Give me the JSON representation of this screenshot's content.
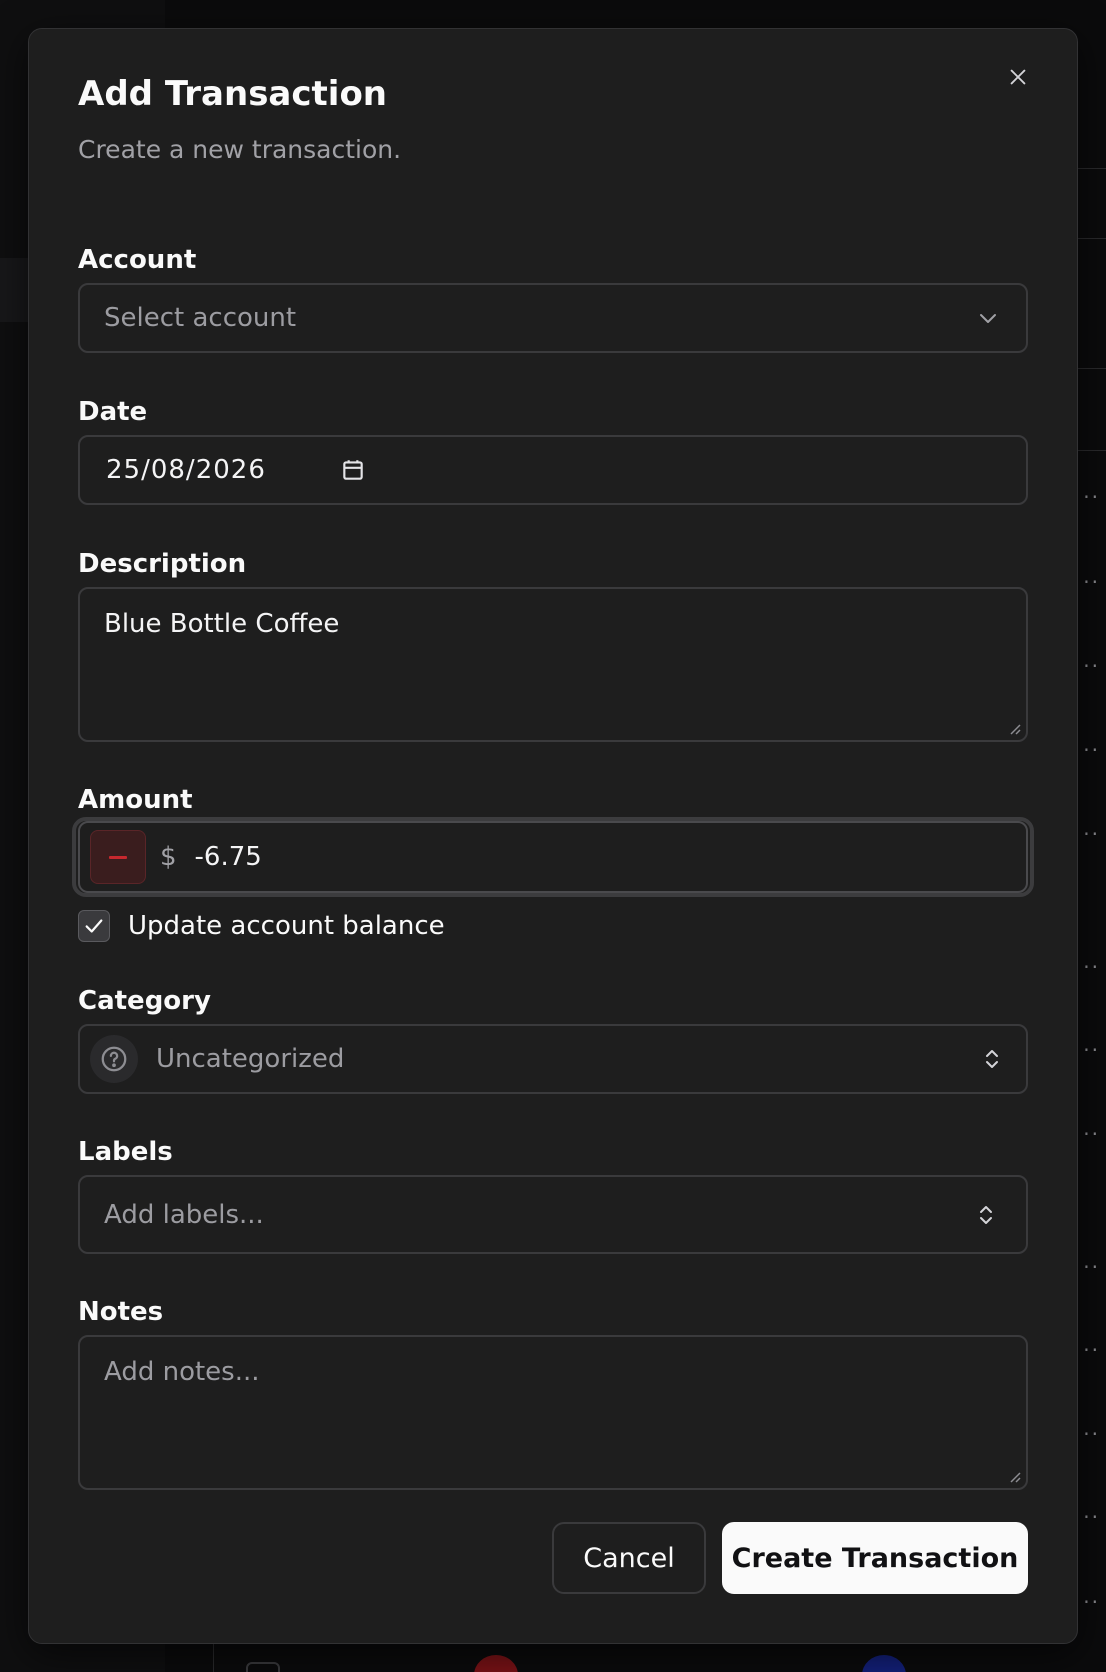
{
  "dialog": {
    "title": "Add Transaction",
    "subtitle": "Create a new transaction."
  },
  "form": {
    "account": {
      "label": "Account",
      "placeholder": "Select account"
    },
    "date": {
      "label": "Date",
      "value": "25/08/2026"
    },
    "description": {
      "label": "Description",
      "value": "Blue Bottle Coffee"
    },
    "amount": {
      "label": "Amount",
      "currency_symbol": "$",
      "value": "-6.75"
    },
    "update_balance": {
      "label": "Update account balance",
      "checked": true
    },
    "category": {
      "label": "Category",
      "value": "Uncategorized"
    },
    "labels": {
      "label": "Labels",
      "placeholder": "Add labels..."
    },
    "notes": {
      "label": "Notes",
      "placeholder": "Add notes..."
    }
  },
  "actions": {
    "cancel_label": "Cancel",
    "create_label": "Create Transaction"
  },
  "icons": {
    "close": "close-icon",
    "account_dropdown": "chevron-down-icon",
    "date_picker": "calendar-icon",
    "amount_sign": "minus-icon",
    "checkbox": "check-icon",
    "category": "question-circle-icon",
    "category_dropdown": "chevrons-up-down-icon",
    "labels_dropdown": "chevrons-up-down-icon"
  },
  "colors": {
    "dialog_bg": "#1e1e1e",
    "negative_accent": "#c7282e",
    "primary_button_bg": "#fafafa"
  }
}
